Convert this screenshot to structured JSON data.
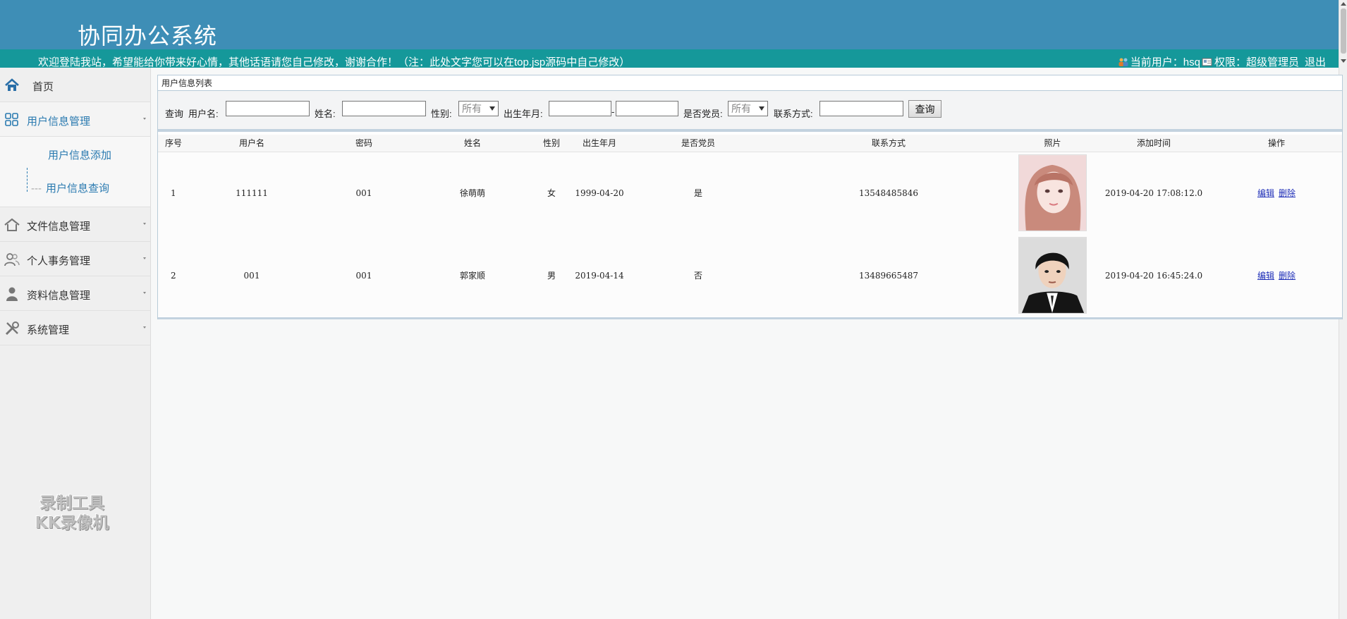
{
  "header": {
    "title": "协同办公系统",
    "welcome": "欢迎登陆我站，希望能给你带来好心情，其他话语请您自己修改，谢谢合作！（注：此处文字您可以在top.jsp源码中自己修改）",
    "current_user_label": "当前用户：hsq",
    "role_label": "权限：超级管理员",
    "logout_label": "退出"
  },
  "sidebar": {
    "items": [
      {
        "label": "首页",
        "icon": "home-icon"
      },
      {
        "label": "用户信息管理",
        "icon": "grid-icon"
      },
      {
        "label": "文件信息管理",
        "icon": "house-icon"
      },
      {
        "label": "个人事务管理",
        "icon": "users-icon"
      },
      {
        "label": "资料信息管理",
        "icon": "person-icon"
      },
      {
        "label": "系统管理",
        "icon": "tools-icon"
      }
    ],
    "subitems": [
      {
        "label": "用户信息添加"
      },
      {
        "label": "用户信息查询"
      }
    ],
    "watermark_line1": "录制工具",
    "watermark_line2": "KK录像机"
  },
  "panel": {
    "title": "用户信息列表",
    "search": {
      "query_label": "查询",
      "username_label": "用户名:",
      "username_value": "",
      "name_label": "姓名:",
      "name_value": "",
      "gender_label": "性别:",
      "gender_selected": "所有",
      "birth_label": "出生年月:",
      "birth_from": "",
      "birth_separator": "-",
      "birth_to": "",
      "party_label": "是否党员:",
      "party_selected": "所有",
      "contact_label": "联系方式:",
      "contact_value": "",
      "query_button": "查询"
    },
    "columns": [
      "序号",
      "用户名",
      "密码",
      "姓名",
      "性别",
      "出生年月",
      "是否党员",
      "联系方式",
      "照片",
      "添加时间",
      "操作"
    ],
    "rows": [
      {
        "index": "1",
        "username": "111111",
        "password": "001",
        "name": "徐萌萌",
        "gender": "女",
        "birth": "1999-04-20",
        "party": "是",
        "contact": "13548485846",
        "added": "2019-04-20 17:08:12.0",
        "edit": "编辑",
        "delete": "删除"
      },
      {
        "index": "2",
        "username": "001",
        "password": "001",
        "name": "郭家顺",
        "gender": "男",
        "birth": "2019-04-14",
        "party": "否",
        "contact": "13489665487",
        "added": "2019-04-20 16:45:24.0",
        "edit": "编辑",
        "delete": "删除"
      }
    ]
  },
  "colors": {
    "header_bg": "#3e8eb6",
    "welcome_bg": "#15989a",
    "accent_text": "#2a7ab0",
    "link": "#1f2fb8"
  }
}
